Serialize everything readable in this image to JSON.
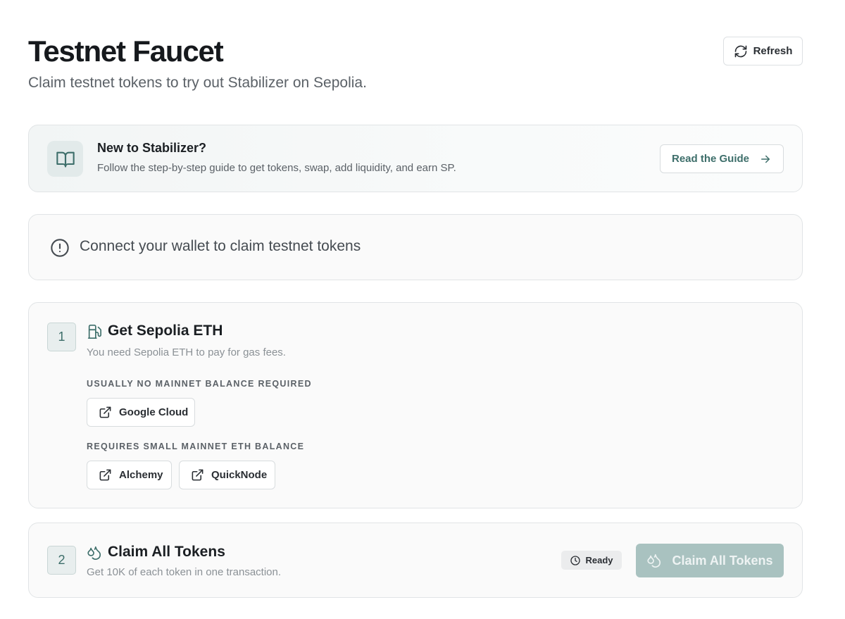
{
  "header": {
    "title": "Testnet Faucet",
    "subtitle": "Claim testnet tokens to try out Stabilizer on Sepolia.",
    "refresh_label": "Refresh"
  },
  "guide": {
    "title": "New to Stabilizer?",
    "description": "Follow the step-by-step guide to get tokens, swap, add liquidity, and earn SP.",
    "button_label": "Read the Guide"
  },
  "wallet_notice": {
    "text": "Connect your wallet to claim testnet tokens"
  },
  "step1": {
    "number": "1",
    "title": "Get Sepolia ETH",
    "description": "You need Sepolia ETH to pay for gas fees.",
    "section_no_balance": "USUALLY NO MAINNET BALANCE REQUIRED",
    "section_small_balance": "REQUIRES SMALL MAINNET ETH BALANCE",
    "links": {
      "google_cloud": "Google Cloud",
      "alchemy": "Alchemy",
      "quicknode": "QuickNode"
    }
  },
  "step2": {
    "number": "2",
    "title": "Claim All Tokens",
    "description": "Get 10K of each token in one transaction.",
    "status": "Ready",
    "button_label": "Claim All Tokens"
  },
  "colors": {
    "accent": "#3d6e6a",
    "claim_button_disabled": "#a9c2c0",
    "card_background": "#fafafa"
  }
}
